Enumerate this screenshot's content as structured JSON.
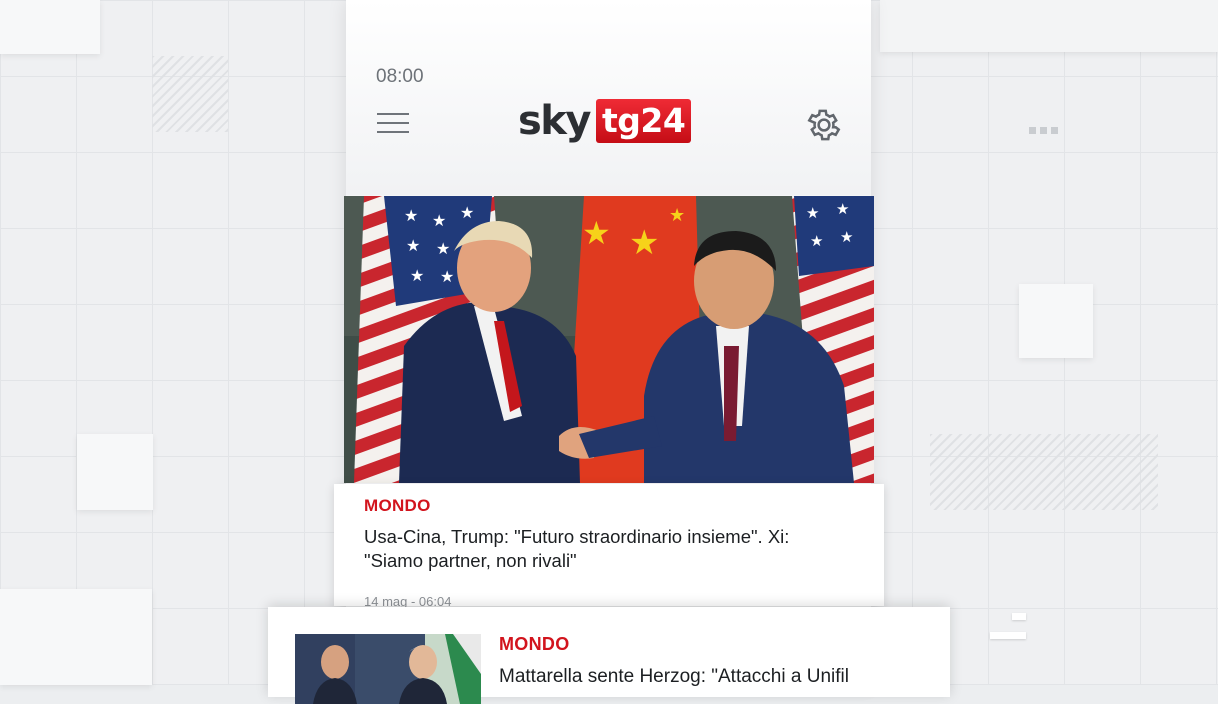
{
  "status_bar": {
    "time": "08:00"
  },
  "header": {
    "logo_sky": "sky",
    "logo_tg": "tg24",
    "menu_icon": "hamburger-menu-icon",
    "settings_icon": "gear-icon"
  },
  "articles": [
    {
      "section": "MONDO",
      "title": "Usa-Cina, Trump: \"Futuro straordinario insieme\". Xi: \"Siamo partner, non rivali\"",
      "date": "14 mag - 06:04"
    },
    {
      "section": "MONDO",
      "title": "Mattarella sente Herzog: \"Attacchi a Unifil"
    }
  ],
  "colors": {
    "accent": "#d2141d",
    "text": "#1c1f22",
    "muted": "#8d9196"
  }
}
